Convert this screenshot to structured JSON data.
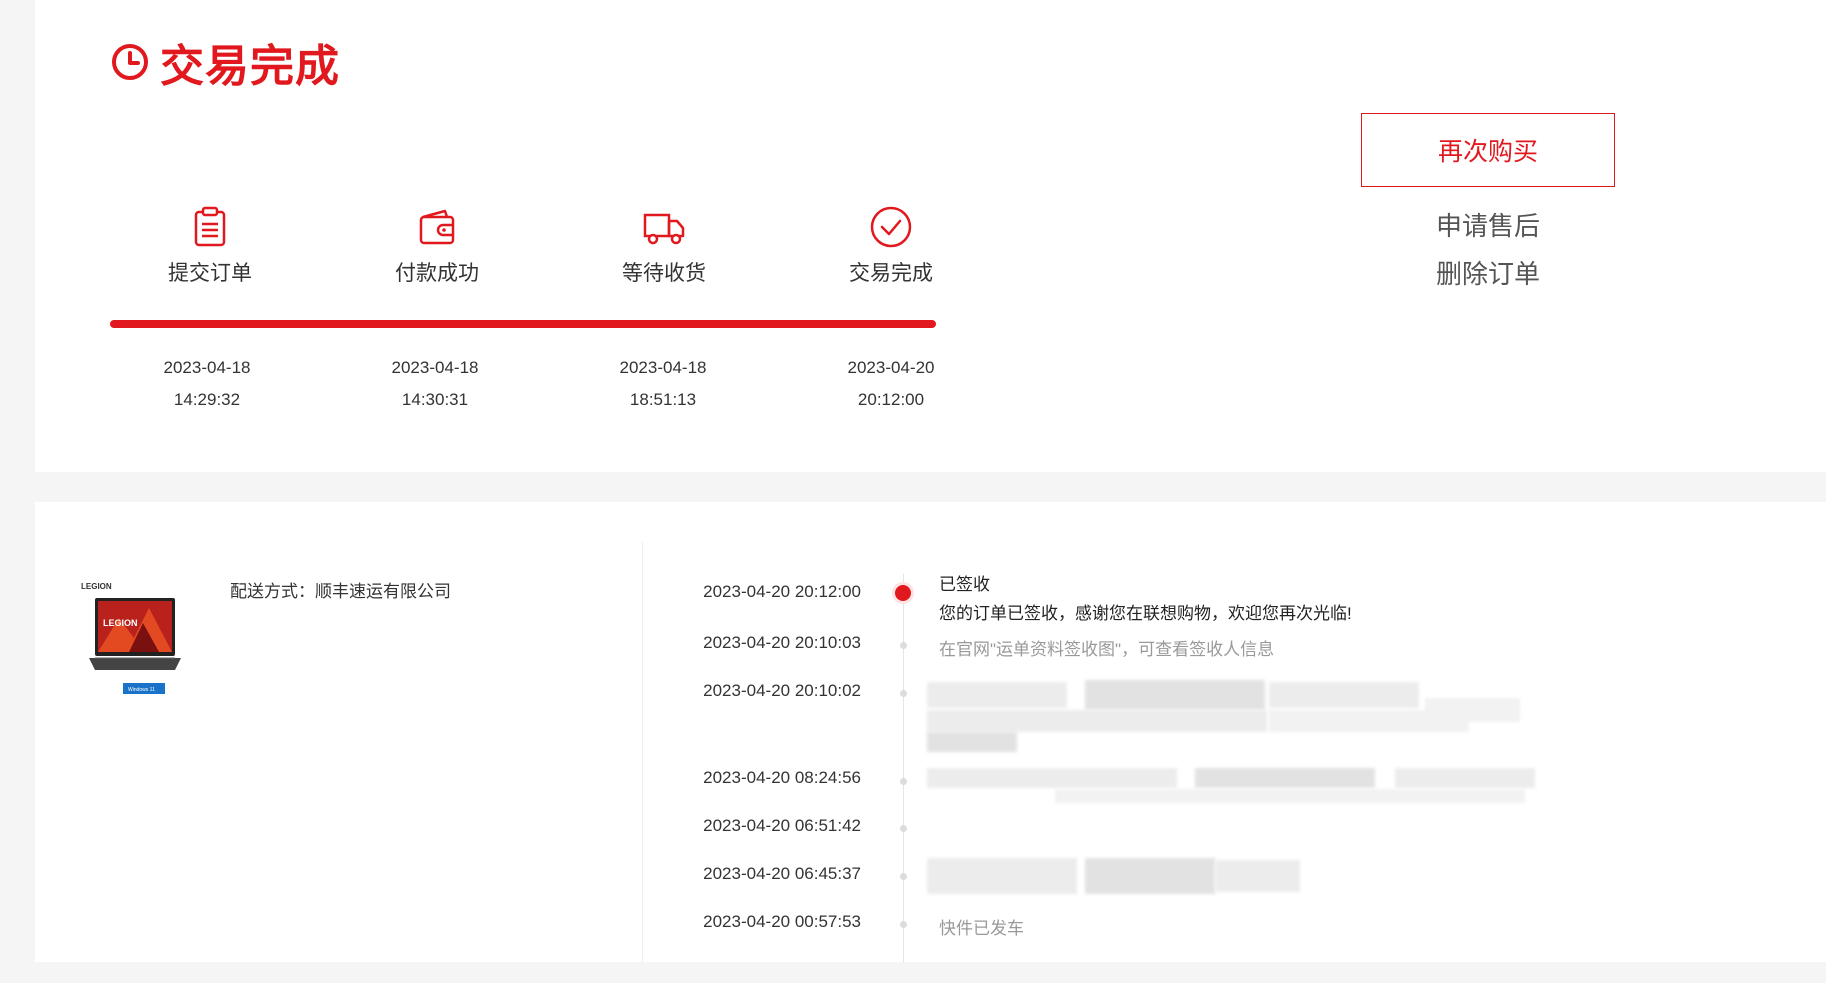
{
  "status": {
    "title": "交易完成",
    "accent_color": "#e1191e",
    "icon": "clock-icon"
  },
  "steps": [
    {
      "icon": "clipboard-icon",
      "label": "提交订单",
      "date": "2023-04-18",
      "time": "14:29:32"
    },
    {
      "icon": "wallet-icon",
      "label": "付款成功",
      "date": "2023-04-18",
      "time": "14:30:31"
    },
    {
      "icon": "truck-icon",
      "label": "等待收货",
      "date": "2023-04-18",
      "time": "18:51:13"
    },
    {
      "icon": "check-circle-icon",
      "label": "交易完成",
      "date": "2023-04-20",
      "time": "20:12:00"
    }
  ],
  "actions": {
    "rebuy": "再次购买",
    "after_sales": "申请售后",
    "delete": "删除订单"
  },
  "product": {
    "brand": "LEGION",
    "screen_text": "LEGION",
    "badge": "Windows 11"
  },
  "shipping": {
    "label": "配送方式：",
    "carrier": "顺丰速运有限公司"
  },
  "timeline": [
    {
      "time": "2023-04-20 20:12:00",
      "title": "已签收",
      "text": "您的订单已签收，感谢您在联想购物，欢迎您再次光临!"
    },
    {
      "time": "2023-04-20 20:10:03",
      "text": "在官网\"运单资料签收图\"，可查看签收人信息"
    },
    {
      "time": "2023-04-20 20:10:02",
      "text": ""
    },
    {
      "time": "2023-04-20 08:24:56",
      "text": ""
    },
    {
      "time": "2023-04-20 06:51:42",
      "text": ""
    },
    {
      "time": "2023-04-20 06:45:37",
      "text": ""
    },
    {
      "time": "2023-04-20 00:57:53",
      "text": "快件已发车"
    }
  ]
}
